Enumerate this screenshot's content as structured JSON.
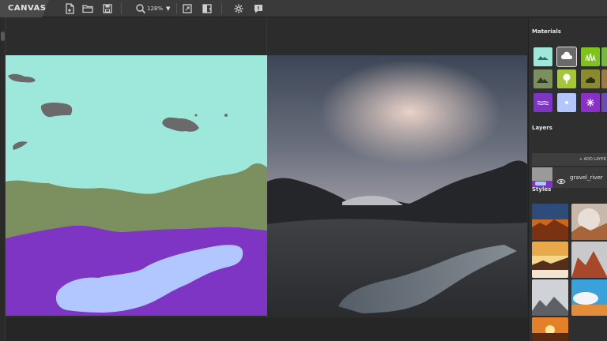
{
  "app": {
    "title": "CANVAS"
  },
  "toolbar": {
    "zoom_value": "128%",
    "icons": [
      "new-file-icon",
      "open-folder-icon",
      "save-icon",
      "zoom-icon",
      "zoom-dropdown-icon",
      "expand-icon",
      "split-view-icon",
      "settings-gear-icon",
      "feedback-icon"
    ]
  },
  "panel": {
    "materials_title": "Materials",
    "layers_title": "Layers",
    "add_layer_label": "+ ADD LAYER",
    "layer_name": "gravel_river",
    "styles_title": "Styles",
    "materials": [
      {
        "name": "sky",
        "color": "#9de8da",
        "icon": "landscape-icon"
      },
      {
        "name": "cloud",
        "color": "#6a6a6a",
        "icon": "cloud-icon",
        "selected": true
      },
      {
        "name": "grass",
        "color": "#7ec31c",
        "icon": "grass-icon"
      },
      {
        "name": "mountain",
        "color": "#7c8f5e",
        "icon": "mountain-icon"
      },
      {
        "name": "tree",
        "color": "#a6c63a",
        "icon": "tree-icon"
      },
      {
        "name": "bush",
        "color": "#8a8a2e",
        "icon": "bush-icon"
      },
      {
        "name": "water",
        "color": "#7f35c4",
        "icon": "water-icon"
      },
      {
        "name": "snow",
        "color": "#b2c6ff",
        "icon": "snow-icon"
      },
      {
        "name": "flower",
        "color": "#8a30c8",
        "icon": "flower-icon"
      }
    ]
  },
  "colors": {
    "sky": "#9de8da",
    "cloud": "#6a6a6a",
    "mountain": "#7c8f5e",
    "water": "#7f35c4",
    "river": "#b2c6ff"
  }
}
